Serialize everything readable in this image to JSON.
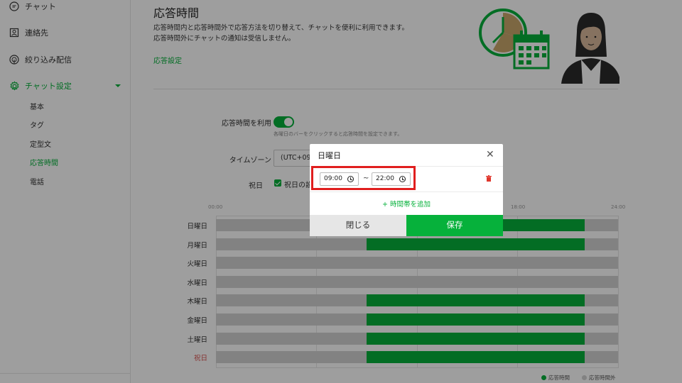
{
  "sidebar": {
    "items": [
      {
        "label": "チャット",
        "icon": "chat-bubble-icon"
      },
      {
        "label": "連絡先",
        "icon": "contact-card-icon"
      },
      {
        "label": "絞り込み配信",
        "icon": "broadcast-icon"
      },
      {
        "label": "チャット設定",
        "icon": "gear-icon"
      }
    ],
    "sub_items": [
      "基本",
      "タグ",
      "定型文",
      "応答時間",
      "電話"
    ],
    "active_item": "チャット設定",
    "active_sub_item": "応答時間"
  },
  "main": {
    "title": "応答時間",
    "description_line1": "応答時間内と応答時間外で応答方法を切り替えて、チャットを便利に利用できます。",
    "description_line2": "応答時間外にチャットの通知は受信しません。",
    "settings_link": "応答設定"
  },
  "form": {
    "use_response_time_label": "応答時間を利用",
    "use_response_time_on": true,
    "hint": "各曜日のバーをクリックすると応答時間を設定できます。",
    "timezone_label": "タイムゾーン",
    "timezone_value": "(UTC+09:00",
    "holiday_label": "祝日",
    "holiday_checkbox_label": "祝日の設",
    "holiday_checked": true
  },
  "schedule": {
    "ticks": [
      "00:00",
      "18:00",
      "24:00"
    ],
    "days": [
      {
        "label": "日曜日",
        "start": 9,
        "end": 22
      },
      {
        "label": "月曜日",
        "start": 9,
        "end": 22
      },
      {
        "label": "火曜日",
        "start": null,
        "end": null
      },
      {
        "label": "水曜日",
        "start": null,
        "end": null
      },
      {
        "label": "木曜日",
        "start": 9,
        "end": 22
      },
      {
        "label": "金曜日",
        "start": 9,
        "end": 22
      },
      {
        "label": "土曜日",
        "start": 9,
        "end": 22
      },
      {
        "label": "祝日",
        "start": 9,
        "end": 22,
        "holiday": true
      }
    ],
    "legend_on": "応答時間",
    "legend_off": "応答時間外",
    "color_on": "#06b13b",
    "color_off": "#d2d2d2"
  },
  "modal": {
    "title": "日曜日",
    "start_time": "09:00",
    "end_time": "22:00",
    "separator": "~",
    "add_slot": "+ 時間帯を追加",
    "close_label": "閉じる",
    "save_label": "保存"
  }
}
